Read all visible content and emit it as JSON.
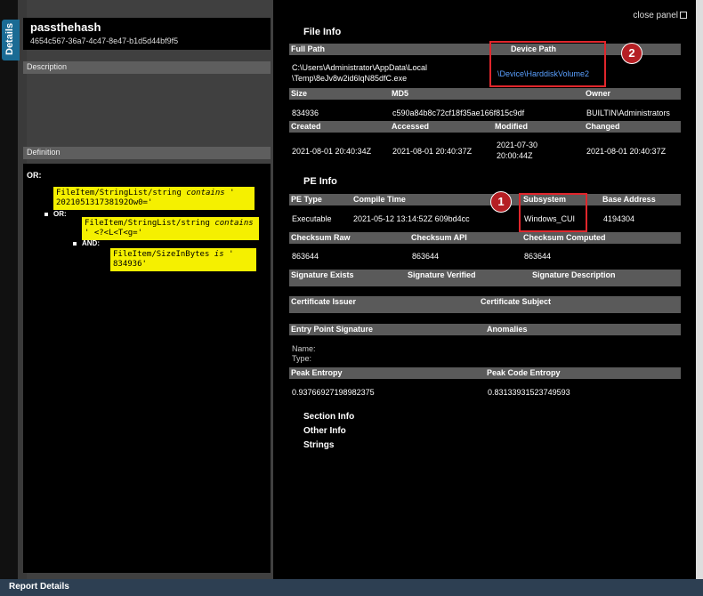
{
  "left": {
    "tab_label": "Details",
    "title": "passthehash",
    "id": "4654c567-36a7-4c47-8e47-b1d5d44bf9f5",
    "description_label": "Description",
    "definition_label": "Definition",
    "root_op": "OR:",
    "nested_or": "OR:",
    "and_op": "AND:",
    "conditions": [
      {
        "field": "FileItem/StringList/string",
        "op": "contains",
        "value": "' 202105131738192Ow0='"
      },
      {
        "field": "FileItem/StringList/string",
        "op": "contains",
        "value": "' <?<L<T<g='"
      },
      {
        "field": "FileItem/SizeInBytes",
        "op": "is",
        "value": "' 834936'"
      }
    ]
  },
  "bottom_label": "Report Details",
  "right": {
    "close_label": "close panel",
    "file_info": "File Info",
    "full_path_label": "Full Path",
    "device_path_label": "Device Path",
    "full_path_value": "C:\\Users\\Administrator\\AppData\\Local\\Temp\\8eJv8w2id6lqN85dfC.exe",
    "full_path_line1": "C:\\Users\\Administrator\\AppData\\Local",
    "full_path_line2": "\\Temp\\8eJv8w2id6lqN85dfC.exe",
    "device_path_value": "\\Device\\HarddiskVolume2",
    "size_label": "Size",
    "md5_label": "MD5",
    "owner_label": "Owner",
    "size_value": "834936",
    "md5_value": "c590a84b8c72cf18f35ae166f815c9df",
    "owner_value": "BUILTIN\\Administrators",
    "created_label": "Created",
    "accessed_label": "Accessed",
    "modified_label": "Modified",
    "changed_label": "Changed",
    "created_value": "2021-08-01 20:40:34Z",
    "accessed_value": "2021-08-01 20:40:37Z",
    "modified_line1": "2021-07-30",
    "modified_line2": "20:00:44Z",
    "changed_value": "2021-08-01 20:40:37Z",
    "pe_info": "PE Info",
    "pe_type_label": "PE Type",
    "compile_time_label": "Compile Time",
    "subsystem_label": "Subsystem",
    "base_address_label": "Base Address",
    "pe_type_value": "Executable",
    "compile_time_value": "2021-05-12 13:14:52Z 609bd4cc",
    "subsystem_value": "Windows_CUI",
    "base_address_value": "4194304",
    "checksum_raw_label": "Checksum Raw",
    "checksum_api_label": "Checksum API",
    "checksum_computed_label": "Checksum Computed",
    "checksum_raw_value": "863644",
    "checksum_api_value": "863644",
    "checksum_computed_value": "863644",
    "sig_exists_label": "Signature Exists",
    "sig_verified_label": "Signature Verified",
    "sig_desc_label": "Signature Description",
    "cert_issuer_label": "Certificate Issuer",
    "cert_subject_label": "Certificate Subject",
    "entry_point_label": "Entry Point Signature",
    "anomalies_label": "Anomalies",
    "name_label": "Name:",
    "type_label": "Type:",
    "peak_entropy_label": "Peak Entropy",
    "peak_code_entropy_label": "Peak Code Entropy",
    "peak_entropy_value": "0.93766927198982375",
    "peak_code_entropy_value": "0.83133931523749593",
    "section_info": "Section Info",
    "other_info": "Other Info",
    "strings": "Strings",
    "badge1": "1",
    "badge2": "2"
  }
}
